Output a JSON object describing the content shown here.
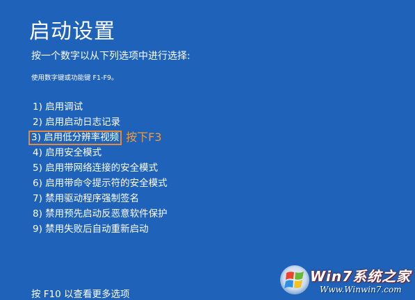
{
  "title": "启动设置",
  "subtitle": "按一个数字以从下列选项中进行选择:",
  "hint": "使用数字键或功能键 F1-F9。",
  "options": [
    {
      "label": "1) 启用调试"
    },
    {
      "label": "2) 启用启动日志记录"
    },
    {
      "label": "3) 启用低分辨率视频",
      "highlighted": true
    },
    {
      "label": "4) 启用安全模式"
    },
    {
      "label": "5) 启用带网络连接的安全模式"
    },
    {
      "label": "6) 启用带命令提示符的安全模式"
    },
    {
      "label": "7) 禁用驱动程序强制签名"
    },
    {
      "label": "8) 禁用预先启动反恶意软件保护"
    },
    {
      "label": "9) 禁用失败后自动重新启动"
    }
  ],
  "annotation": "按下F3",
  "footer": "按 F10 以查看更多选项",
  "watermark": {
    "brand": "Win7系统之家",
    "url": "Www.Winwin7.com"
  },
  "colors": {
    "background": "#1f62b9",
    "highlight_border": "#e8893a",
    "annotation": "#f29a3a"
  }
}
